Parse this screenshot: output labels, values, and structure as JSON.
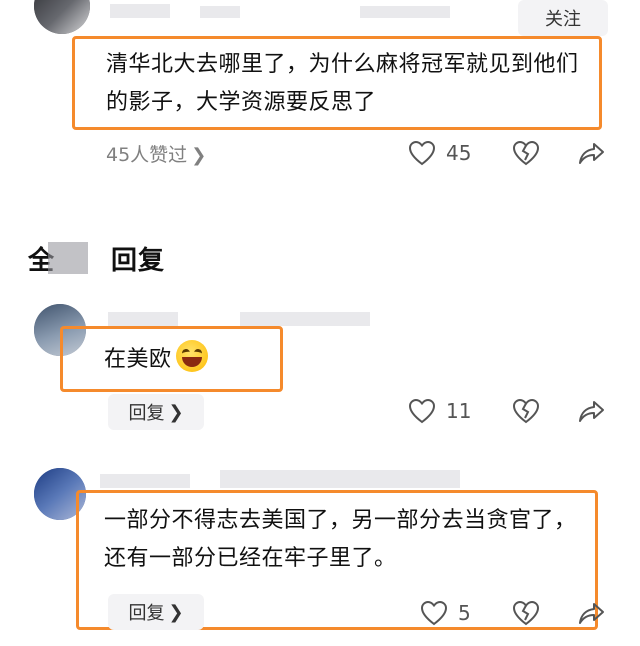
{
  "top_comment": {
    "follow_label": "关注",
    "text": "清华北大去哪里了，为什么麻将冠军就见到他们的影子，大学资源要反思了",
    "likers_text": "45人赞过",
    "like_count": "45"
  },
  "section": {
    "title_left": "全",
    "title_right": "回复"
  },
  "replies": [
    {
      "text": "在美欧",
      "reply_label": "回复",
      "like_count": "11"
    },
    {
      "text": "一部分不得志去美国了，另一部分去当贪官了，还有一部分已经在牢子里了。",
      "reply_label": "回复",
      "like_count": "5"
    }
  ],
  "icons": {
    "like": "heart-outline-icon",
    "dislike": "broken-heart-icon",
    "share": "share-arrow-icon",
    "chevron": "chevron-right-icon"
  },
  "colors": {
    "highlight": "#f58a2c",
    "muted_text": "#808080"
  }
}
